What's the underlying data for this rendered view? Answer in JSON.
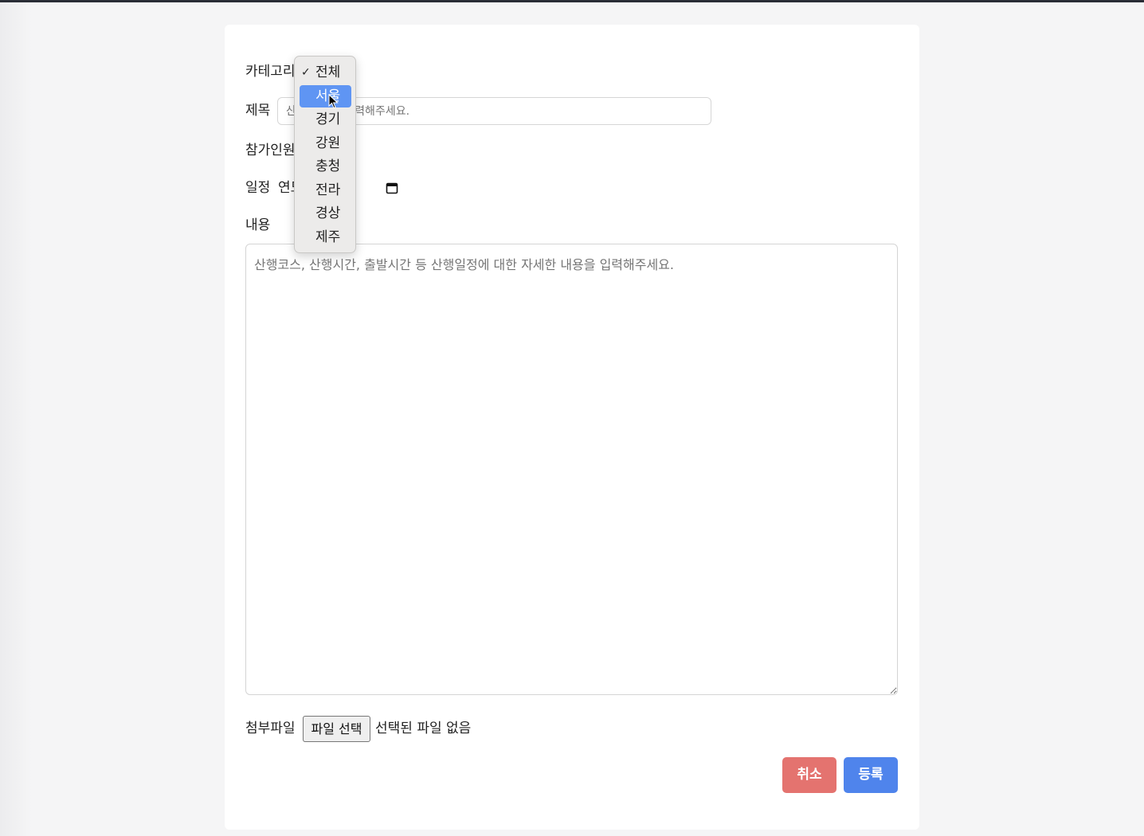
{
  "form": {
    "category_label": "카테고리",
    "title_label": "제목",
    "title_placeholder": "산행 제목을 입력해주세요.",
    "participants_label": "참가인원",
    "schedule_label": "일정",
    "date_placeholder": "연도. 월. 일.",
    "content_label": "내용",
    "content_placeholder": "산행코스, 산행시간, 출발시간 등 산행일정에 대한 자세한 내용을 입력해주세요.",
    "attachment_label": "첨부파일",
    "file_button": "파일 선택",
    "file_status": "선택된 파일 없음",
    "cancel_button": "취소",
    "submit_button": "등록"
  },
  "category_dropdown": {
    "selected": "전체",
    "hovered": "서울",
    "options": [
      "전체",
      "서울",
      "경기",
      "강원",
      "충청",
      "전라",
      "경상",
      "제주"
    ]
  },
  "icons": {
    "date": "calendar-icon",
    "checkmark": "check-icon",
    "pointer": "mouse-cursor-icon",
    "resize": "resize-grip-icon"
  },
  "colors": {
    "cancel": "#e4736f",
    "submit": "#4f84ec",
    "option_highlight": "#5f95f3"
  }
}
